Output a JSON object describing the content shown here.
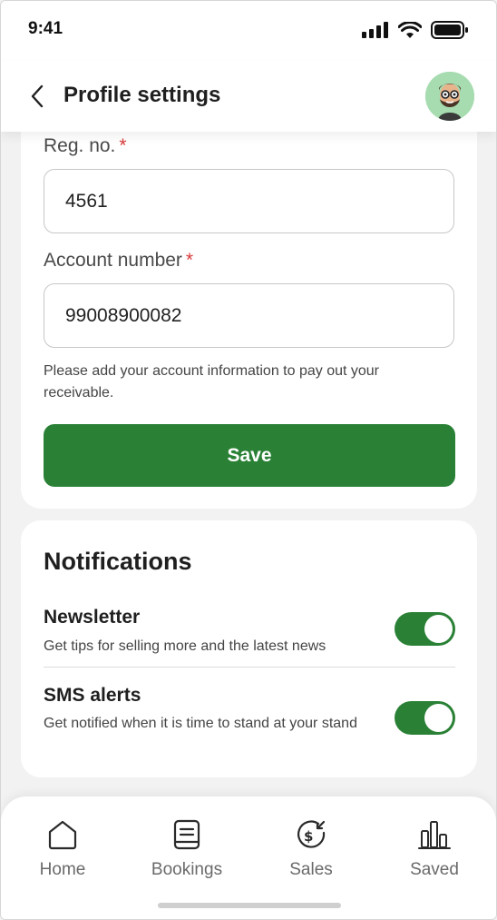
{
  "status_bar": {
    "time": "9:41"
  },
  "header": {
    "title": "Profile settings"
  },
  "account": {
    "reg_label": "Reg. no.",
    "reg_value": "4561",
    "account_label": "Account number",
    "account_value": "99008900082",
    "required_mark": "*",
    "helper": "Please add your account information to pay out your receivable.",
    "save_label": "Save"
  },
  "notifications": {
    "title": "Notifications",
    "items": [
      {
        "title": "Newsletter",
        "description": "Get tips for selling more and the latest news",
        "enabled": true
      },
      {
        "title": "SMS alerts",
        "description": "Get notified when it is time to stand at your stand",
        "enabled": true
      }
    ]
  },
  "nav": {
    "items": [
      {
        "label": "Home",
        "icon": "home-icon"
      },
      {
        "label": "Bookings",
        "icon": "bookings-icon"
      },
      {
        "label": "Sales",
        "icon": "sales-icon"
      },
      {
        "label": "Saved",
        "icon": "saved-chart-icon"
      }
    ]
  },
  "colors": {
    "accent": "#2a8136",
    "required": "#d93b3b",
    "avatar_bg": "#a6dcb0"
  }
}
